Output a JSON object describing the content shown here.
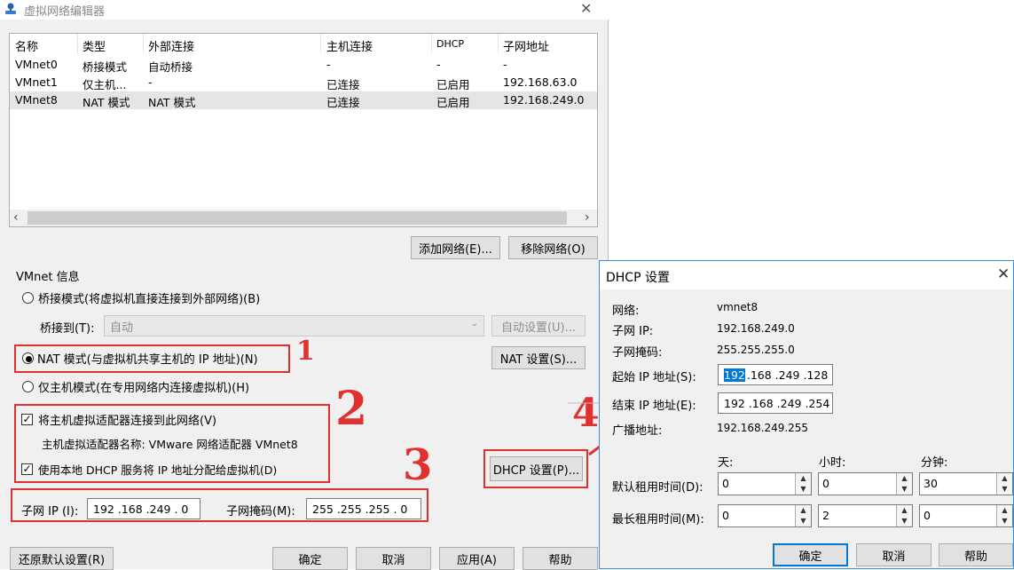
{
  "main": {
    "title": "虚拟网络编辑器",
    "close_glyph": "✕",
    "table": {
      "headers": [
        "名称",
        "类型",
        "外部连接",
        "主机连接",
        "DHCP",
        "子网地址"
      ],
      "rows": [
        [
          "VMnet0",
          "桥接模式",
          "自动桥接",
          "-",
          "-",
          "-"
        ],
        [
          "VMnet1",
          "仅主机...",
          "-",
          "已连接",
          "已启用",
          "192.168.63.0"
        ],
        [
          "VMnet8",
          "NAT 模式",
          "NAT 模式",
          "已连接",
          "已启用",
          "192.168.249.0"
        ]
      ]
    },
    "add_network": "添加网络(E)...",
    "remove_network": "移除网络(O)",
    "vmnet_info": "VMnet 信息",
    "bridge_mode": "桥接模式(将虚拟机直接连接到外部网络)(B)",
    "bridge_to_label": "桥接到(T):",
    "bridge_to_value": "自动",
    "auto_settings": "自动设置(U)...",
    "nat_mode": "NAT 模式(与虚拟机共享主机的 IP 地址)(N)",
    "nat_settings": "NAT 设置(S)...",
    "host_only": "仅主机模式(在专用网络内连接虚拟机)(H)",
    "connect_adapter": "将主机虚拟适配器连接到此网络(V)",
    "adapter_name": "主机虚拟适配器名称: VMware 网络适配器 VMnet8",
    "use_dhcp": "使用本地 DHCP 服务将 IP 地址分配给虚拟机(D)",
    "dhcp_settings": "DHCP 设置(P)...",
    "subnet_ip_label": "子网 IP (I):",
    "subnet_ip_value": "192 .168 .249 . 0",
    "subnet_mask_label": "子网掩码(M):",
    "subnet_mask_value": "255 .255 .255 . 0",
    "restore_defaults": "还原默认设置(R)",
    "ok": "确定",
    "cancel": "取消",
    "apply": "应用(A)",
    "help": "帮助"
  },
  "annotations": {
    "n1": "1",
    "n2": "2",
    "n3": "3",
    "n4": "4"
  },
  "dhcp": {
    "title": "DHCP 设置",
    "close_glyph": "✕",
    "network_label": "网络:",
    "network_value": "vmnet8",
    "subnet_ip_label": "子网 IP:",
    "subnet_ip_value": "192.168.249.0",
    "subnet_mask_label": "子网掩码:",
    "subnet_mask_value": "255.255.255.0",
    "start_ip_label": "起始 IP 地址(S):",
    "start_ip_selected": "192",
    "start_ip_rest": ".168 .249 .128",
    "end_ip_label": "结束 IP 地址(E):",
    "end_ip_value": "192 .168 .249 .254",
    "broadcast_label": "广播地址:",
    "broadcast_value": "192.168.249.255",
    "days": "天:",
    "hours": "小时:",
    "minutes": "分钟:",
    "default_lease_label": "默认租用时间(D):",
    "default_lease": [
      "0",
      "0",
      "30"
    ],
    "max_lease_label": "最长租用时间(M):",
    "max_lease": [
      "0",
      "2",
      "0"
    ],
    "ok": "确定",
    "cancel": "取消",
    "help": "帮助"
  },
  "colors": {
    "annotation_red": "#e03030",
    "selection_blue": "#0078d7"
  }
}
